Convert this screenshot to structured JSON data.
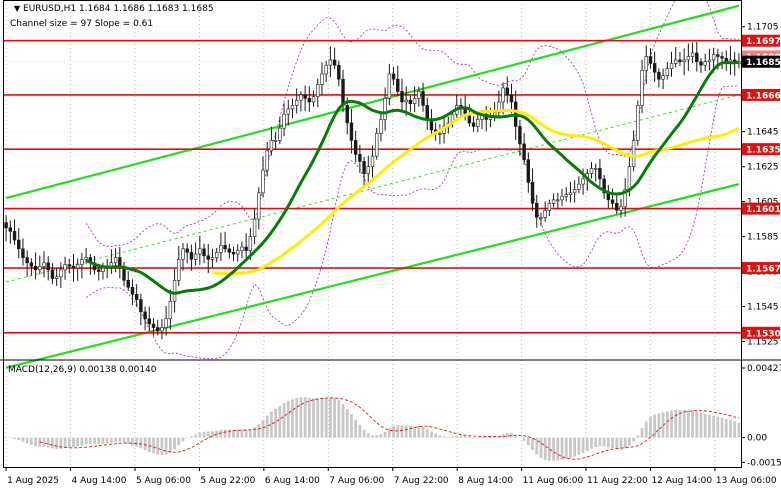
{
  "chart_data": {
    "type": "candlestick",
    "symbol_line": "EURUSD,H1  1.1684 1.1686 1.1683 1.1685",
    "info_line": "Channel size = 97 Slope = 0.61",
    "price_axis": {
      "range": [
        1.1515,
        1.1718
      ],
      "ticks": [
        "1.1705",
        "1.1685",
        "1.1665",
        "1.1645",
        "1.1625",
        "1.1605",
        "1.1585",
        "1.1565",
        "1.1545",
        "1.1525"
      ],
      "tick_values": [
        1.1705,
        1.1685,
        1.1665,
        1.1645,
        1.1625,
        1.1605,
        1.1585,
        1.1565,
        1.1545,
        1.1525
      ]
    },
    "x_axis_labels": [
      "1 Aug 2025",
      "4 Aug 14:00",
      "5 Aug 06:00",
      "5 Aug 22:00",
      "6 Aug 14:00",
      "7 Aug 06:00",
      "7 Aug 22:00",
      "8 Aug 14:00",
      "11 Aug 06:00",
      "11 Aug 22:00",
      "12 Aug 14:00",
      "13 Aug 06:00"
    ],
    "bar_count": 175,
    "levels": [
      {
        "price": 1.1697,
        "label": "1.1697",
        "color": "#e01010"
      },
      {
        "price": 1.1666,
        "label": "1.1666",
        "color": "#e01010"
      },
      {
        "price": 1.1635,
        "label": "1.1635",
        "color": "#e01010"
      },
      {
        "price": 1.1601,
        "label": "1.1601",
        "color": "#e01010"
      },
      {
        "price": 1.1567,
        "label": "1.1567",
        "color": "#e01010"
      },
      {
        "price": 1.153,
        "label": "1.1530",
        "color": "#e01010"
      }
    ],
    "current_price": {
      "price": 1.1685,
      "label": "1.1685"
    },
    "ask_price": {
      "price": 1.1688,
      "label": "1.1688"
    },
    "closes": [
      1.159,
      1.1588,
      1.1583,
      1.1578,
      1.1573,
      1.157,
      1.1568,
      1.1566,
      1.1568,
      1.157,
      1.1566,
      1.1561,
      1.1562,
      1.1566,
      1.1569,
      1.1568,
      1.1567,
      1.1569,
      1.1572,
      1.1573,
      1.157,
      1.1566,
      1.1565,
      1.1567,
      1.1568,
      1.157,
      1.1573,
      1.1567,
      1.156,
      1.1556,
      1.1552,
      1.1549,
      1.1542,
      1.1538,
      1.1535,
      1.1533,
      1.1531,
      1.1533,
      1.1538,
      1.1548,
      1.156,
      1.1572,
      1.1578,
      1.1576,
      1.1572,
      1.1575,
      1.1578,
      1.1574,
      1.1572,
      1.1573,
      1.1576,
      1.158,
      1.1578,
      1.1576,
      1.1575,
      1.1577,
      1.1579,
      1.1577,
      1.1585,
      1.1595,
      1.161,
      1.1623,
      1.1634,
      1.164,
      1.164,
      1.1647,
      1.1655,
      1.1658,
      1.166,
      1.1663,
      1.1666,
      1.1664,
      1.1662,
      1.1665,
      1.1672,
      1.1678,
      1.1683,
      1.1686,
      1.1683,
      1.1675,
      1.166,
      1.165,
      1.164,
      1.1632,
      1.1628,
      1.1621,
      1.1625,
      1.1631,
      1.1644,
      1.1652,
      1.1664,
      1.1678,
      1.1675,
      1.1668,
      1.1662,
      1.1663,
      1.1661,
      1.1664,
      1.1668,
      1.166,
      1.1652,
      1.1646,
      1.1644,
      1.1644,
      1.1648,
      1.165,
      1.1655,
      1.166,
      1.1658,
      1.1654,
      1.165,
      1.1648,
      1.1652,
      1.1655,
      1.1652,
      1.1654,
      1.1656,
      1.1662,
      1.167,
      1.1666,
      1.1662,
      1.1648,
      1.1638,
      1.1629,
      1.1616,
      1.1604,
      1.1596,
      1.1596,
      1.16,
      1.1604,
      1.1606,
      1.1606,
      1.1608,
      1.1609,
      1.161,
      1.1612,
      1.1615,
      1.1618,
      1.1621,
      1.1624,
      1.1624,
      1.1618,
      1.161,
      1.1606,
      1.1604,
      1.16,
      1.1602,
      1.1612,
      1.1625,
      1.164,
      1.166,
      1.168,
      1.1688,
      1.1684,
      1.1679,
      1.1675,
      1.1677,
      1.1681,
      1.1684,
      1.1686,
      1.1685,
      1.1686,
      1.1688,
      1.169,
      1.1685,
      1.1683,
      1.1685,
      1.1686,
      1.1689,
      1.1688,
      1.1687,
      1.1685,
      1.1686,
      1.1684,
      1.1685
    ],
    "channel": {
      "color": "#22dd22",
      "upper": [
        [
          0,
          1.1607
        ],
        [
          174,
          1.1717
        ]
      ],
      "middle": [
        [
          0,
          1.1559
        ],
        [
          174,
          1.1666
        ]
      ],
      "lower": [
        [
          0,
          1.151
        ],
        [
          174,
          1.1615
        ]
      ]
    },
    "moving_averages": [
      {
        "color": "#ffee00",
        "period": 50
      },
      {
        "color": "#0a7a0a",
        "period": 20
      }
    ],
    "envelope_color": "#a020c0",
    "macd": {
      "label": "MACD(12,26,9) 0.00138 0.00140",
      "ticks": [
        "0.00427",
        "0.00",
        "-0.00152"
      ],
      "tick_values": [
        0.00427,
        0.0,
        -0.00152
      ],
      "range": [
        -0.0018,
        0.0047
      ],
      "histogram_color": "#c8c8c8",
      "signal_color": "#e01010"
    },
    "colors": {
      "bull": "#1a1a1a",
      "bear": "#1a1a1a",
      "axis_label_bg": "#e01010",
      "axis_label_fg": "#ffffff"
    }
  }
}
